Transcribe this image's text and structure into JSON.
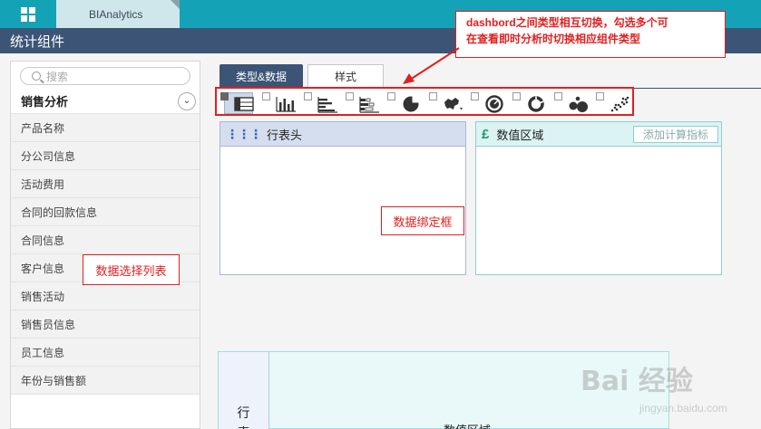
{
  "app": {
    "tab_title": "BIAnalytics",
    "page_title": "统计组件"
  },
  "sidebar": {
    "search_placeholder": "搜索",
    "category": "销售分析",
    "items": [
      {
        "label": "产品名称"
      },
      {
        "label": "分公司信息"
      },
      {
        "label": "活动费用"
      },
      {
        "label": "合同的回款信息"
      },
      {
        "label": "合同信息"
      },
      {
        "label": "客户信息"
      },
      {
        "label": "销售活动"
      },
      {
        "label": "销售员信息"
      },
      {
        "label": "员工信息"
      },
      {
        "label": "年份与销售额"
      }
    ]
  },
  "tabs": {
    "type_data": "类型&数据",
    "style": "样式"
  },
  "chart_types": [
    "table-icon",
    "bar-chart-icon",
    "horizontal-bar-icon",
    "stacked-bar-icon",
    "pie-icon",
    "map-icon",
    "gauge-icon",
    "donut-icon",
    "bubble-icon",
    "scatter-icon"
  ],
  "panels": {
    "row_header": "行表头",
    "value_area": "数值区域",
    "add_metric": "添加计算指标"
  },
  "annotations": {
    "top_line1": "dashbord之间类型相互切换，勾选多个可",
    "top_line2": "在查看即时分析时切换相应组件类型",
    "binding": "数据绑定框",
    "list": "数据选择列表"
  },
  "preview": {
    "row_char1": "行",
    "row_char2": "表",
    "value_label": "数值区域"
  },
  "watermark": {
    "big": "Bai 经验",
    "small": "jingyan.baidu.com"
  },
  "colors": {
    "topbar": "#14a3b6",
    "titlebar": "#3c5476",
    "annotation": "#e02020"
  }
}
